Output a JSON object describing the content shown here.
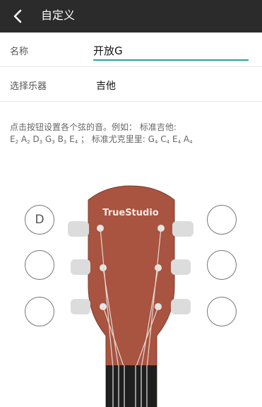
{
  "header": {
    "title": "自定义",
    "back_icon": "chevron-left-icon"
  },
  "form": {
    "name_label": "名称",
    "name_value": "开放G",
    "instrument_label": "选择乐器",
    "instrument_value": "吉他"
  },
  "help": {
    "line1": "点击按钮设置各个弦的音。例如： 标准吉他:",
    "line2_standard": [
      "E2",
      "A2",
      "D3",
      "G3",
      "B3",
      "E4"
    ],
    "line2_uke_label": "标准尤克里里:",
    "line2_uke": [
      "G4",
      "C4",
      "E4",
      "A4"
    ]
  },
  "headstock": {
    "brand": "TrueStudio",
    "color": "#a85440"
  },
  "strings": {
    "left": [
      "D",
      "",
      ""
    ],
    "right": [
      "",
      "",
      ""
    ]
  }
}
